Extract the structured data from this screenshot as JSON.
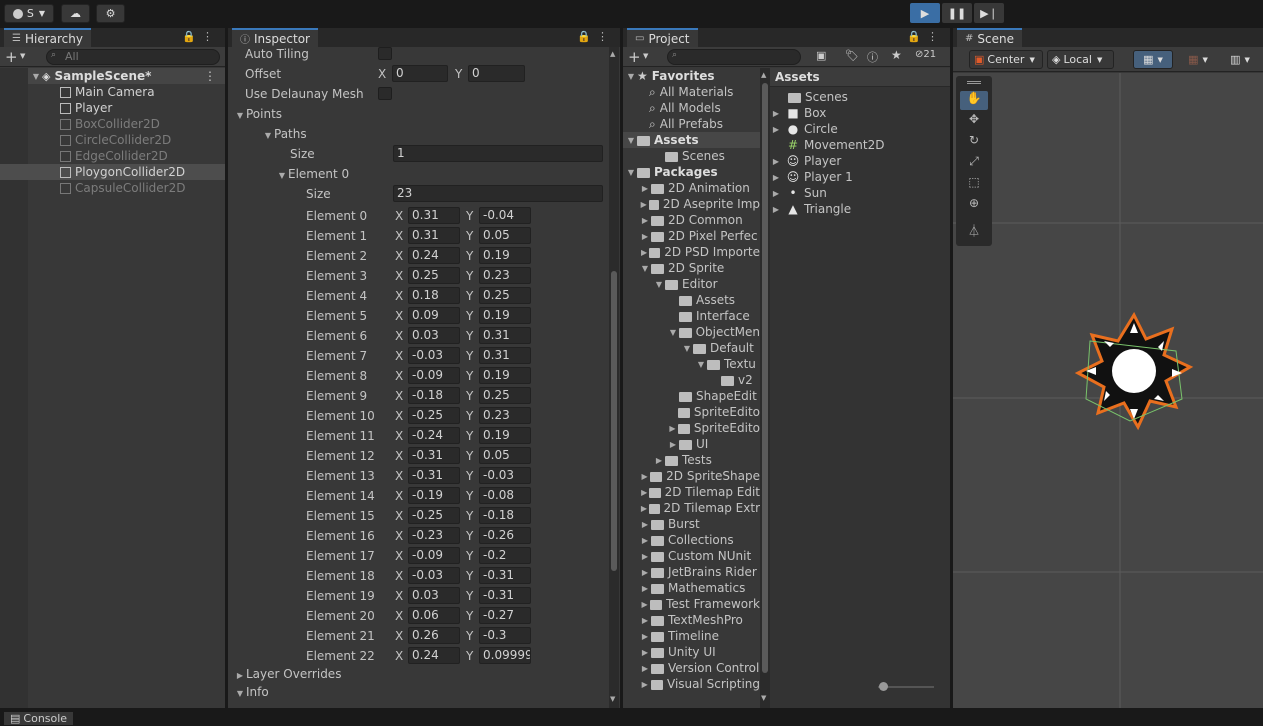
{
  "toolbar": {
    "account": "S",
    "play_color": "#3a6ea5"
  },
  "hierarchy": {
    "tab": "Hierarchy",
    "search_placeholder": "All",
    "scene": "SampleScene*",
    "items": [
      {
        "label": "Main Camera",
        "disabled": false,
        "selected": false
      },
      {
        "label": "Player",
        "disabled": false,
        "selected": false
      },
      {
        "label": "BoxCollider2D",
        "disabled": true,
        "selected": false
      },
      {
        "label": "CircleCollider2D",
        "disabled": true,
        "selected": false
      },
      {
        "label": "EdgeCollider2D",
        "disabled": true,
        "selected": false
      },
      {
        "label": "PloygonCollider2D",
        "disabled": false,
        "selected": true
      },
      {
        "label": "CapsuleCollider2D",
        "disabled": true,
        "selected": false
      }
    ]
  },
  "inspector": {
    "tab": "Inspector",
    "auto_tiling": "Auto Tiling",
    "offset": "Offset",
    "offset_x": "0",
    "offset_y": "0",
    "delaunay": "Use Delaunay Mesh",
    "points": "Points",
    "paths": "Paths",
    "size_label": "Size",
    "paths_size": "1",
    "element0": "Element 0",
    "element0_size": "23",
    "elements": [
      {
        "name": "Element 0",
        "x": "0.31",
        "y": "-0.04"
      },
      {
        "name": "Element 1",
        "x": "0.31",
        "y": "0.05"
      },
      {
        "name": "Element 2",
        "x": "0.24",
        "y": "0.19"
      },
      {
        "name": "Element 3",
        "x": "0.25",
        "y": "0.23"
      },
      {
        "name": "Element 4",
        "x": "0.18",
        "y": "0.25"
      },
      {
        "name": "Element 5",
        "x": "0.09",
        "y": "0.19"
      },
      {
        "name": "Element 6",
        "x": "0.03",
        "y": "0.31"
      },
      {
        "name": "Element 7",
        "x": "-0.03",
        "y": "0.31"
      },
      {
        "name": "Element 8",
        "x": "-0.09",
        "y": "0.19"
      },
      {
        "name": "Element 9",
        "x": "-0.18",
        "y": "0.25"
      },
      {
        "name": "Element 10",
        "x": "-0.25",
        "y": "0.23"
      },
      {
        "name": "Element 11",
        "x": "-0.24",
        "y": "0.19"
      },
      {
        "name": "Element 12",
        "x": "-0.31",
        "y": "0.05"
      },
      {
        "name": "Element 13",
        "x": "-0.31",
        "y": "-0.03"
      },
      {
        "name": "Element 14",
        "x": "-0.19",
        "y": "-0.08"
      },
      {
        "name": "Element 15",
        "x": "-0.25",
        "y": "-0.18"
      },
      {
        "name": "Element 16",
        "x": "-0.23",
        "y": "-0.26"
      },
      {
        "name": "Element 17",
        "x": "-0.09",
        "y": "-0.2"
      },
      {
        "name": "Element 18",
        "x": "-0.03",
        "y": "-0.31"
      },
      {
        "name": "Element 19",
        "x": "0.03",
        "y": "-0.31"
      },
      {
        "name": "Element 20",
        "x": "0.06",
        "y": "-0.27"
      },
      {
        "name": "Element 21",
        "x": "0.26",
        "y": "-0.3"
      },
      {
        "name": "Element 22",
        "x": "0.24",
        "y": "0.09999"
      }
    ],
    "x": "X",
    "y": "Y",
    "layer_overrides": "Layer Overrides",
    "info": "Info"
  },
  "project": {
    "tab": "Project",
    "badge": "21",
    "tree": [
      {
        "label": "Favorites",
        "depth": 0,
        "arrow": "open",
        "icon": "star",
        "bold": true
      },
      {
        "label": "All Materials",
        "depth": 2,
        "arrow": "",
        "icon": "search"
      },
      {
        "label": "All Models",
        "depth": 2,
        "arrow": "",
        "icon": "search"
      },
      {
        "label": "All Prefabs",
        "depth": 2,
        "arrow": "",
        "icon": "search"
      },
      {
        "label": "Assets",
        "depth": 0,
        "arrow": "open",
        "icon": "folder",
        "bold": true,
        "highlight": true
      },
      {
        "label": "Scenes",
        "depth": 2,
        "arrow": "",
        "icon": "folder"
      },
      {
        "label": "Packages",
        "depth": 0,
        "arrow": "open",
        "icon": "folder",
        "bold": true
      },
      {
        "label": "2D Animation",
        "depth": 1,
        "arrow": "closed",
        "icon": "folder"
      },
      {
        "label": "2D Aseprite Imp",
        "depth": 1,
        "arrow": "closed",
        "icon": "folder"
      },
      {
        "label": "2D Common",
        "depth": 1,
        "arrow": "closed",
        "icon": "folder"
      },
      {
        "label": "2D Pixel Perfec",
        "depth": 1,
        "arrow": "closed",
        "icon": "folder"
      },
      {
        "label": "2D PSD Importe",
        "depth": 1,
        "arrow": "closed",
        "icon": "folder"
      },
      {
        "label": "2D Sprite",
        "depth": 1,
        "arrow": "open",
        "icon": "folder"
      },
      {
        "label": "Editor",
        "depth": 2,
        "arrow": "open",
        "icon": "folder"
      },
      {
        "label": "Assets",
        "depth": 3,
        "arrow": "",
        "icon": "folder"
      },
      {
        "label": "Interface",
        "depth": 3,
        "arrow": "",
        "icon": "folder"
      },
      {
        "label": "ObjectMen",
        "depth": 3,
        "arrow": "open",
        "icon": "folder"
      },
      {
        "label": "Default",
        "depth": 4,
        "arrow": "open",
        "icon": "folder"
      },
      {
        "label": "Textu",
        "depth": 5,
        "arrow": "open",
        "icon": "folder"
      },
      {
        "label": "v2",
        "depth": 6,
        "arrow": "",
        "icon": "folder"
      },
      {
        "label": "ShapeEdit",
        "depth": 3,
        "arrow": "",
        "icon": "folder"
      },
      {
        "label": "SpriteEdito",
        "depth": 3,
        "arrow": "",
        "icon": "folder"
      },
      {
        "label": "SpriteEdito",
        "depth": 3,
        "arrow": "closed",
        "icon": "folder"
      },
      {
        "label": "UI",
        "depth": 3,
        "arrow": "closed",
        "icon": "folder"
      },
      {
        "label": "Tests",
        "depth": 2,
        "arrow": "closed",
        "icon": "folder"
      },
      {
        "label": "2D SpriteShape",
        "depth": 1,
        "arrow": "closed",
        "icon": "folder"
      },
      {
        "label": "2D Tilemap Edit",
        "depth": 1,
        "arrow": "closed",
        "icon": "folder"
      },
      {
        "label": "2D Tilemap Extr",
        "depth": 1,
        "arrow": "closed",
        "icon": "folder"
      },
      {
        "label": "Burst",
        "depth": 1,
        "arrow": "closed",
        "icon": "folder"
      },
      {
        "label": "Collections",
        "depth": 1,
        "arrow": "closed",
        "icon": "folder"
      },
      {
        "label": "Custom NUnit",
        "depth": 1,
        "arrow": "closed",
        "icon": "folder"
      },
      {
        "label": "JetBrains Rider",
        "depth": 1,
        "arrow": "closed",
        "icon": "folder"
      },
      {
        "label": "Mathematics",
        "depth": 1,
        "arrow": "closed",
        "icon": "folder"
      },
      {
        "label": "Test Framework",
        "depth": 1,
        "arrow": "closed",
        "icon": "folder"
      },
      {
        "label": "TextMeshPro",
        "depth": 1,
        "arrow": "closed",
        "icon": "folder"
      },
      {
        "label": "Timeline",
        "depth": 1,
        "arrow": "closed",
        "icon": "folder"
      },
      {
        "label": "Unity UI",
        "depth": 1,
        "arrow": "closed",
        "icon": "folder"
      },
      {
        "label": "Version Control",
        "depth": 1,
        "arrow": "closed",
        "icon": "folder"
      },
      {
        "label": "Visual Scripting",
        "depth": 1,
        "arrow": "closed",
        "icon": "folder"
      }
    ],
    "assets_header": "Assets",
    "assets": [
      {
        "label": "Scenes",
        "icon": "folder",
        "arrow": false
      },
      {
        "label": "Box",
        "icon": "square",
        "arrow": true
      },
      {
        "label": "Circle",
        "icon": "circle",
        "arrow": true
      },
      {
        "label": "Movement2D",
        "icon": "script",
        "arrow": false
      },
      {
        "label": "Player",
        "icon": "face",
        "arrow": true
      },
      {
        "label": "Player 1",
        "icon": "face",
        "arrow": true
      },
      {
        "label": "Sun",
        "icon": "dot",
        "arrow": true
      },
      {
        "label": "Triangle",
        "icon": "triangle",
        "arrow": true
      }
    ]
  },
  "scene": {
    "tab": "Scene",
    "pivot": "Center",
    "space": "Local"
  },
  "console": {
    "tab": "Console"
  }
}
